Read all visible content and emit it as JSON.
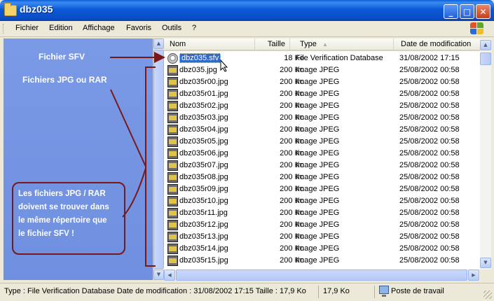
{
  "window": {
    "title": "dbz035",
    "minimize": "_",
    "maximize": "□",
    "close": "✕"
  },
  "menu": {
    "items": [
      "Fichier",
      "Edition",
      "Affichage",
      "Favoris",
      "Outils",
      "?"
    ]
  },
  "annotations": {
    "sfv_label": "Fichier SFV",
    "jpg_rar_label": "Fichiers JPG ou RAR",
    "note_lines": [
      "Les fichiers JPG / RAR",
      "doivent se trouver dans",
      "le même répertoire que",
      "le fichier SFV !"
    ]
  },
  "columns": {
    "name": "Nom",
    "size": "Taille",
    "type": "Type",
    "date": "Date de modification"
  },
  "files": [
    {
      "name": "dbz035.sfv",
      "size": "18 Ko",
      "type": "File Verification Database",
      "date": "31/08/2002 17:15",
      "icon": "sfv-icon",
      "selected": true
    },
    {
      "name": "dbz035.jpg",
      "size": "200 Ko",
      "type": "Image JPEG",
      "date": "25/08/2002 00:58",
      "icon": "jpg-icon"
    },
    {
      "name": "dbz035r00.jpg",
      "size": "200 Ko",
      "type": "Image JPEG",
      "date": "25/08/2002 00:58",
      "icon": "jpg-icon"
    },
    {
      "name": "dbz035r01.jpg",
      "size": "200 Ko",
      "type": "Image JPEG",
      "date": "25/08/2002 00:58",
      "icon": "jpg-icon"
    },
    {
      "name": "dbz035r02.jpg",
      "size": "200 Ko",
      "type": "Image JPEG",
      "date": "25/08/2002 00:58",
      "icon": "jpg-icon"
    },
    {
      "name": "dbz035r03.jpg",
      "size": "200 Ko",
      "type": "Image JPEG",
      "date": "25/08/2002 00:58",
      "icon": "jpg-icon"
    },
    {
      "name": "dbz035r04.jpg",
      "size": "200 Ko",
      "type": "Image JPEG",
      "date": "25/08/2002 00:58",
      "icon": "jpg-icon"
    },
    {
      "name": "dbz035r05.jpg",
      "size": "200 Ko",
      "type": "Image JPEG",
      "date": "25/08/2002 00:58",
      "icon": "jpg-icon"
    },
    {
      "name": "dbz035r06.jpg",
      "size": "200 Ko",
      "type": "Image JPEG",
      "date": "25/08/2002 00:58",
      "icon": "jpg-icon"
    },
    {
      "name": "dbz035r07.jpg",
      "size": "200 Ko",
      "type": "Image JPEG",
      "date": "25/08/2002 00:58",
      "icon": "jpg-icon"
    },
    {
      "name": "dbz035r08.jpg",
      "size": "200 Ko",
      "type": "Image JPEG",
      "date": "25/08/2002 00:58",
      "icon": "jpg-icon"
    },
    {
      "name": "dbz035r09.jpg",
      "size": "200 Ko",
      "type": "Image JPEG",
      "date": "25/08/2002 00:58",
      "icon": "jpg-icon"
    },
    {
      "name": "dbz035r10.jpg",
      "size": "200 Ko",
      "type": "Image JPEG",
      "date": "25/08/2002 00:58",
      "icon": "jpg-icon"
    },
    {
      "name": "dbz035r11.jpg",
      "size": "200 Ko",
      "type": "Image JPEG",
      "date": "25/08/2002 00:58",
      "icon": "jpg-icon"
    },
    {
      "name": "dbz035r12.jpg",
      "size": "200 Ko",
      "type": "Image JPEG",
      "date": "25/08/2002 00:58",
      "icon": "jpg-icon"
    },
    {
      "name": "dbz035r13.jpg",
      "size": "200 Ko",
      "type": "Image JPEG",
      "date": "25/08/2002 00:58",
      "icon": "jpg-icon"
    },
    {
      "name": "dbz035r14.jpg",
      "size": "200 Ko",
      "type": "Image JPEG",
      "date": "25/08/2002 00:58",
      "icon": "jpg-icon"
    },
    {
      "name": "dbz035r15.jpg",
      "size": "200 Ko",
      "type": "Image JPEG",
      "date": "25/08/2002 00:58",
      "icon": "jpg-icon"
    }
  ],
  "status": {
    "description": "Type : File Verification Database Date de modification : 31/08/2002 17:15 Taille  : 17,9 Ko",
    "size": "17,9 Ko",
    "location": "Poste de travail"
  },
  "colors": {
    "titlebar": "#0a4ec8",
    "left_pane": "#7090e0",
    "annotation_arrow": "#7a1818",
    "selection": "#316ac5"
  }
}
